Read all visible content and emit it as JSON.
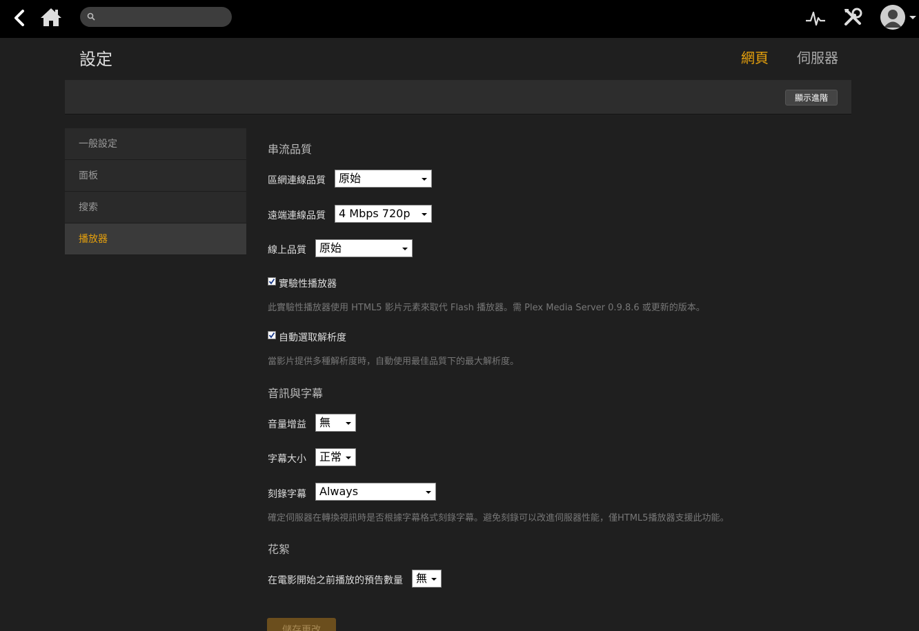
{
  "topbar": {
    "search_placeholder": ""
  },
  "header": {
    "title": "設定",
    "tabs": [
      {
        "label": "網頁",
        "active": true
      },
      {
        "label": "伺服器",
        "active": false
      }
    ],
    "advanced_button": "顯示進階"
  },
  "sidebar": {
    "items": [
      {
        "label": "一般設定"
      },
      {
        "label": "面板"
      },
      {
        "label": "搜索"
      },
      {
        "label": "播放器",
        "active": true
      }
    ]
  },
  "form": {
    "streaming_quality": {
      "title": "串流品質",
      "lan_label": "區網連線品質",
      "lan_value": "原始",
      "remote_label": "遠端連線品質",
      "remote_value": "4 Mbps 720p",
      "online_label": "線上品質",
      "online_value": "原始"
    },
    "experimental_player": {
      "checked": true,
      "label": "實驗性播放器",
      "help": "此實驗性播放器使用 HTML5 影片元素來取代 Flash 播放器。需 Plex Media Server 0.9.8.6 或更新的版本。"
    },
    "auto_resolution": {
      "checked": true,
      "label": "自動選取解析度",
      "help": "當影片提供多種解析度時，自動使用最佳品質下的最大解析度。"
    },
    "audio_subtitles": {
      "title": "音訊與字幕",
      "volume_label": "音量增益",
      "volume_value": "無",
      "subtitle_size_label": "字幕大小",
      "subtitle_size_value": "正常",
      "burn_label": "刻錄字幕",
      "burn_value": "Always",
      "burn_help": "確定伺服器在轉換視訊時是否根據字幕格式刻錄字幕。避免刻錄可以改進伺服器性能，僅HTML5播放器支援此功能。"
    },
    "extras": {
      "title": "花絮",
      "trailers_label": "在電影開始之前播放的預告數量",
      "trailers_value": "無"
    },
    "save_button": "儲存更改"
  },
  "colors": {
    "accent": "#e5a00d",
    "background": "#1f1f1f",
    "topbar": "#000000"
  },
  "icons": [
    "back-arrow-icon",
    "home-icon",
    "search-icon",
    "activity-icon",
    "tools-icon",
    "user-avatar-icon",
    "chevron-down-icon",
    "checkmark-icon"
  ]
}
